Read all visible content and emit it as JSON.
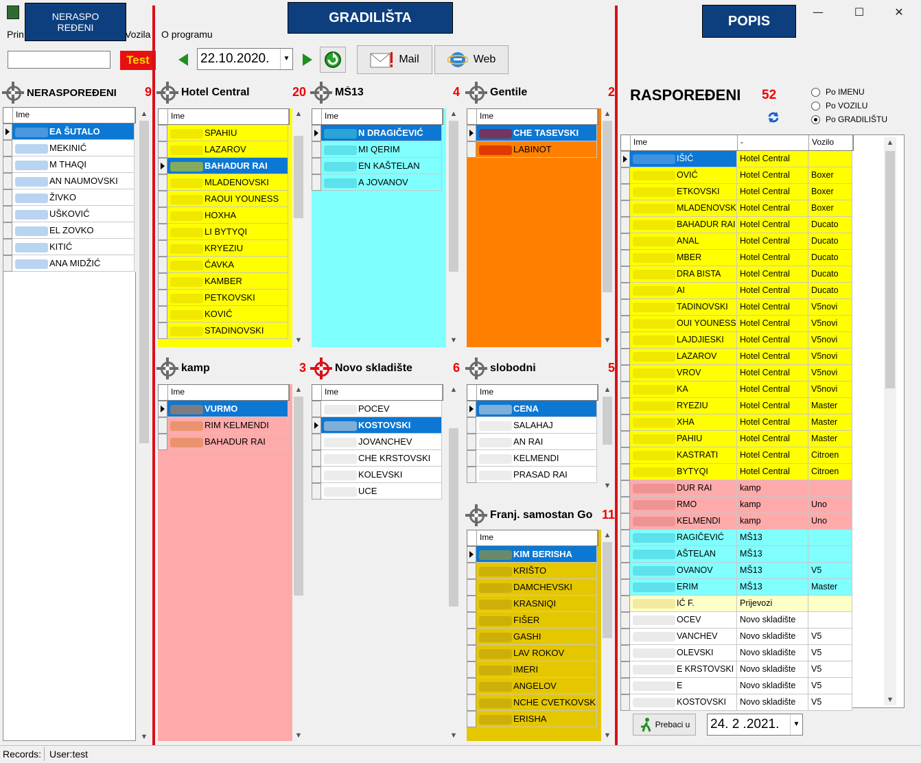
{
  "window": {
    "min": "—",
    "max": "☐",
    "close": "✕"
  },
  "menu": {
    "items": [
      "Prin",
      "Vozila",
      "O programu"
    ]
  },
  "labels": {
    "neraspo": "NERASPO REĐENI",
    "gradilista": "GRADILIŠTA",
    "popis": "POPIS"
  },
  "toolbar": {
    "search_value": "",
    "test_label": "Test",
    "date": "22.10.2020.",
    "mail_label": "Mail",
    "web_label": "Web"
  },
  "panels": {
    "nerasporedeni": {
      "title": "NERASPOREĐENI",
      "count": "9",
      "col": "Ime",
      "rows": [
        "EA ŠUTALO",
        "MEKINIĆ",
        "M THAQI",
        "AN NAUMOVSKI",
        "ŽIVKO",
        "UŠKOVIĆ",
        "EL ZOVKO",
        "KITIĆ",
        "ANA MIDŽIĆ"
      ]
    },
    "hotel_central": {
      "title": "Hotel Central",
      "count": "20",
      "col": "Ime",
      "rows": [
        "SPAHIU",
        "LAZAROV",
        "BAHADUR RAI",
        "MLADENOVSKI",
        "RAOUI YOUNESS",
        "HOXHA",
        "LI BYTYQI",
        "KRYEZIU",
        "ĆAVKA",
        "KAMBER",
        "PETKOVSKI",
        "KOVIĆ",
        "STADINOVSKI"
      ]
    },
    "ms13": {
      "title": "MŠ13",
      "count": "4",
      "col": "Ime",
      "rows": [
        "N DRAGIČEVIĆ",
        "MI QERIM",
        "EN KAŠTELAN",
        "A JOVANOV"
      ]
    },
    "gentile": {
      "title": "Gentile",
      "count": "2",
      "col": "Ime",
      "rows": [
        "CHE TASEVSKI",
        "LABINOT"
      ]
    },
    "kamp": {
      "title": "kamp",
      "count": "3",
      "col": "Ime",
      "rows": [
        "VURMO",
        "RIM KELMENDI",
        "BAHADUR RAI"
      ]
    },
    "novo_skladiste": {
      "title": "Novo skladište",
      "count": "6",
      "col": "Ime",
      "rows": [
        "POCEV",
        "KOSTOVSKI",
        "JOVANCHEV",
        "CHE KRSTOVSKI",
        "KOLEVSKI",
        "UCE"
      ]
    },
    "slobodni": {
      "title": "slobodni",
      "count": "5",
      "col": "Ime",
      "rows": [
        "CENA",
        "SALAHAJ",
        "AN RAI",
        "KELMENDI",
        "PRASAD RAI"
      ]
    },
    "franj": {
      "title": "Franj. samostan Go",
      "count": "11",
      "col": "Ime",
      "rows": [
        "KIM BERISHA",
        "KRIŠTO",
        "DAMCHEVSKI",
        "KRASNIQI",
        "FIŠER",
        "GASHI",
        "LAV ROKOV",
        "IMERI",
        "ANGELOV",
        "NCHE CVETKOVSKI",
        "ERISHA"
      ]
    }
  },
  "raspored": {
    "title": "RASPOREĐENI",
    "count": "52",
    "radio": [
      "Po IMENU",
      "Po VOZILU",
      "Po GRADILIŠTU"
    ],
    "cols": [
      "Ime",
      "-",
      "Vozilo"
    ],
    "rows": [
      [
        "IŠIĆ",
        "Hotel Central",
        ""
      ],
      [
        "OVIĆ",
        "Hotel Central",
        "Boxer"
      ],
      [
        "ETKOVSKI",
        "Hotel Central",
        "Boxer"
      ],
      [
        "MLADENOVSKI",
        "Hotel Central",
        "Boxer"
      ],
      [
        "BAHADUR RAI",
        "Hotel Central",
        "Ducato"
      ],
      [
        "ANAL",
        "Hotel Central",
        "Ducato"
      ],
      [
        "MBER",
        "Hotel Central",
        "Ducato"
      ],
      [
        "DRA BISTA",
        "Hotel Central",
        "Ducato"
      ],
      [
        "AI",
        "Hotel Central",
        "Ducato"
      ],
      [
        "TADINOVSKI",
        "Hotel Central",
        "V5novi"
      ],
      [
        "OUI YOUNESS",
        "Hotel Central",
        "V5novi"
      ],
      [
        "LAJDJIESKI",
        "Hotel Central",
        "V5novi"
      ],
      [
        "LAZAROV",
        "Hotel Central",
        "V5novi"
      ],
      [
        "VROV",
        "Hotel Central",
        "V5novi"
      ],
      [
        "KA",
        "Hotel Central",
        "V5novi"
      ],
      [
        "RYEZIU",
        "Hotel Central",
        "Master"
      ],
      [
        "XHA",
        "Hotel Central",
        "Master"
      ],
      [
        "PAHIU",
        "Hotel Central",
        "Master"
      ],
      [
        "KASTRATI",
        "Hotel Central",
        "Citroen"
      ],
      [
        "BYTYQI",
        "Hotel Central",
        "Citroen"
      ],
      [
        "DUR RAI",
        "kamp",
        ""
      ],
      [
        "RMO",
        "kamp",
        "Uno"
      ],
      [
        "KELMENDI",
        "kamp",
        "Uno"
      ],
      [
        "RAGIČEVIĆ",
        "MŠ13",
        ""
      ],
      [
        "AŠTELAN",
        "MŠ13",
        ""
      ],
      [
        "OVANOV",
        "MŠ13",
        "V5"
      ],
      [
        "ERIM",
        "MŠ13",
        "Master"
      ],
      [
        "IĆ F.",
        "Prijevozi",
        ""
      ],
      [
        "OCEV",
        "Novo skladište",
        ""
      ],
      [
        "VANCHEV",
        "Novo skladište",
        "V5"
      ],
      [
        "OLEVSKI",
        "Novo skladište",
        "V5"
      ],
      [
        "E KRSTOVSKI",
        "Novo skladište",
        "V5"
      ],
      [
        "E",
        "Novo skladište",
        "V5"
      ],
      [
        "KOSTOVSKI",
        "Novo skladište",
        "V5"
      ]
    ],
    "prebaci_label": "Prebaci u",
    "date": "24. 2 .2021."
  },
  "status": {
    "records": "Records:",
    "user": "User:test"
  },
  "colors": {
    "yellow": "#ffff00",
    "cyan": "#80ffff",
    "orange": "#ff8000",
    "pink": "#ffaaaa",
    "olive": "#e5c700",
    "selection": "#0c78d4",
    "label_blue": "#0d3f7e",
    "red": "#d9101a"
  }
}
